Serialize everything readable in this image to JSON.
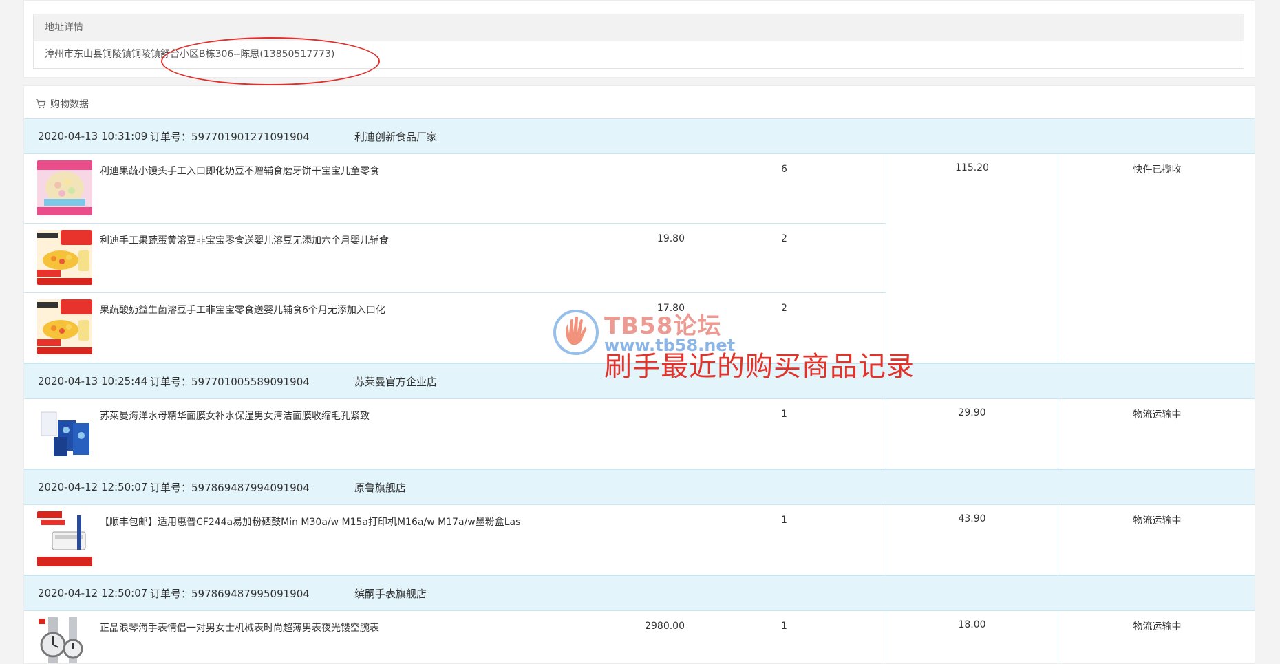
{
  "address": {
    "header": "地址详情",
    "value": "漳州市东山县铜陵镇铜陵镇舒台小区B栋306--陈思(13850517773)"
  },
  "shopping": {
    "title": "购物数据",
    "icon": "cart-icon"
  },
  "orders": [
    {
      "date": "2020-04-13 10:31:09",
      "order_no": "订单号：597701901271091904",
      "shop": "利迪创新食品厂家",
      "amount": "115.20",
      "status": "快件已揽收",
      "items": [
        {
          "title": "利迪果蔬小馒头手工入口即化奶豆不赠辅食磨牙饼干宝宝儿童零食",
          "price": "",
          "qty": "6",
          "thumb": "pink-snack"
        },
        {
          "title": "利迪手工果蔬蛋黄溶豆非宝宝零食送婴儿溶豆无添加六个月婴儿辅食",
          "price": "19.80",
          "qty": "2",
          "thumb": "red-snack"
        },
        {
          "title": "果蔬酸奶益生菌溶豆手工非宝宝零食送婴儿辅食6个月无添加入口化",
          "price": "17.80",
          "qty": "2",
          "thumb": "red-snack"
        }
      ]
    },
    {
      "date": "2020-04-13 10:25:44",
      "order_no": "订单号：597701005589091904",
      "shop": "苏莱曼官方企业店",
      "amount": "29.90",
      "status": "物流运输中",
      "items": [
        {
          "title": "苏莱曼海洋水母精华面膜女补水保湿男女清洁面膜收缩毛孔紧致",
          "price": "",
          "qty": "1",
          "thumb": "mask"
        }
      ]
    },
    {
      "date": "2020-04-12 12:50:07",
      "order_no": "订单号：597869487994091904",
      "shop": "原鲁旗舰店",
      "amount": "43.90",
      "status": "物流运输中",
      "items": [
        {
          "title": "【顺丰包邮】适用惠普CF244a易加粉硒鼓Min M30a/w M15a打印机M16a/w M17a/w墨粉盒Las",
          "price": "",
          "qty": "1",
          "thumb": "toner"
        }
      ]
    },
    {
      "date": "2020-04-12 12:50:07",
      "order_no": "订单号：597869487995091904",
      "shop": "缤嗣手表旗舰店",
      "amount": "18.00",
      "status": "物流运输中",
      "items": [
        {
          "title": "正品浪琴海手表情侣一对男女士机械表时尚超薄男表夜光镂空腕表",
          "price": "2980.00",
          "qty": "1",
          "thumb": "watch"
        }
      ]
    }
  ],
  "watermark": {
    "brand": "TB58论坛",
    "url": "www.tb58.net",
    "caption": "刷手最近的购买商品记录"
  }
}
